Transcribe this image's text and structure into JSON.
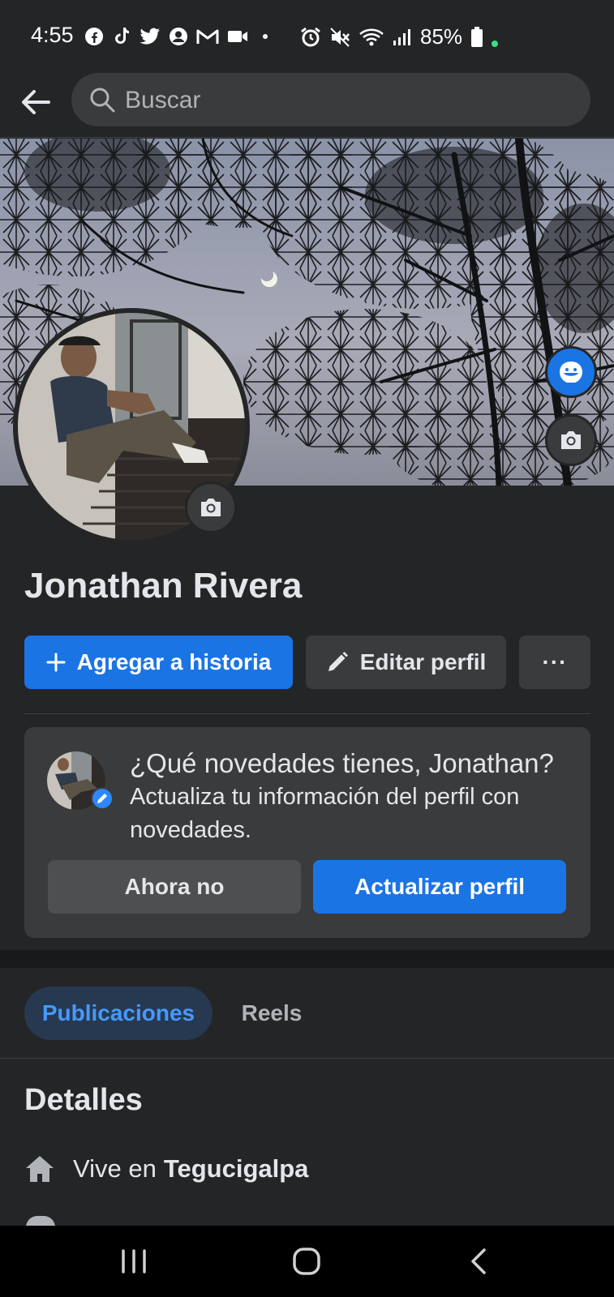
{
  "status_bar": {
    "time": "4:55",
    "battery": "85%",
    "left_icons": [
      "facebook-icon",
      "tiktok-icon",
      "twitter-icon",
      "account-icon",
      "gmail-icon",
      "video-icon",
      "dot"
    ],
    "right_icons": [
      "alarm-icon",
      "mute-icon",
      "wifi-icon",
      "signal-icon",
      "battery-icon"
    ]
  },
  "search": {
    "placeholder": "Buscar"
  },
  "profile": {
    "name": "Jonathan Rivera"
  },
  "actions": {
    "add_story": "Agregar a historia",
    "edit_profile": "Editar perfil",
    "more": "···"
  },
  "update_card": {
    "title": "¿Qué novedades tienes, Jonathan?",
    "text": "Actualiza tu información del perfil con novedades.",
    "dismiss_label": "Ahora no",
    "update_label": "Actualizar perfil"
  },
  "tabs": [
    {
      "label": "Publicaciones",
      "active": true
    },
    {
      "label": "Reels",
      "active": false
    }
  ],
  "details": {
    "title": "Detalles",
    "lives_in_prefix": "Vive en",
    "lives_in_city": "Tegucigalpa"
  },
  "colors": {
    "background": "#242526",
    "surface": "#3a3b3c",
    "accent": "#1b74e4",
    "active_tab_bg": "#263951",
    "active_tab_text": "#4599ff"
  }
}
